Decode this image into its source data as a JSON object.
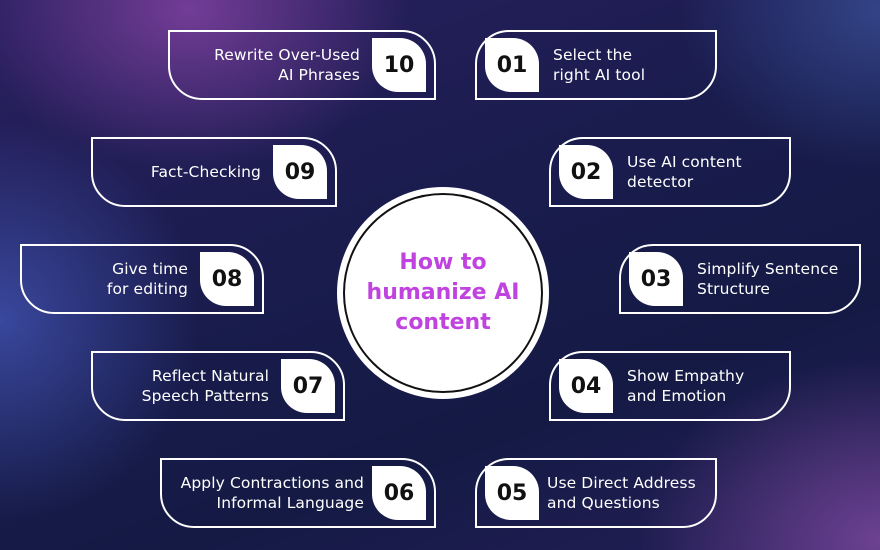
{
  "title": "How to humanize AI content",
  "colors": {
    "accent": "#c043e0",
    "box_border": "#ffffff",
    "badge_bg": "#ffffff",
    "badge_text": "#111111",
    "background": "#1a1c4e"
  },
  "steps": [
    {
      "number": "01",
      "label": "Select the right AI tool"
    },
    {
      "number": "02",
      "label": "Use AI content detector"
    },
    {
      "number": "03",
      "label": "Simplify Sentence Structure"
    },
    {
      "number": "04",
      "label": "Show Empathy and Emotion"
    },
    {
      "number": "05",
      "label": "Use Direct Address and Questions"
    },
    {
      "number": "06",
      "label": "Apply Contractions and Informal Language"
    },
    {
      "number": "07",
      "label": "Reflect Natural Speech Patterns"
    },
    {
      "number": "08",
      "label": "Give time for editing"
    },
    {
      "number": "09",
      "label": "Fact-Checking"
    },
    {
      "number": "10",
      "label": "Rewrite Over-Used AI Phrases"
    }
  ],
  "lines": {
    "s01": [
      "Select the",
      "right AI tool"
    ],
    "s02": [
      "Use AI content",
      "detector"
    ],
    "s03": [
      "Simplify Sentence",
      "Structure"
    ],
    "s04": [
      "Show Empathy",
      "and Emotion"
    ],
    "s05": [
      "Use Direct Address",
      "and Questions"
    ],
    "s06": [
      "Apply Contractions and",
      "Informal Language"
    ],
    "s07": [
      "Reflect Natural",
      "Speech Patterns"
    ],
    "s08": [
      "Give time",
      "for editing"
    ],
    "s09": [
      "Fact-Checking"
    ],
    "s10": [
      "Rewrite Over-Used",
      "AI Phrases"
    ]
  },
  "title_lines": [
    "How to",
    "humanize AI",
    "content"
  ]
}
